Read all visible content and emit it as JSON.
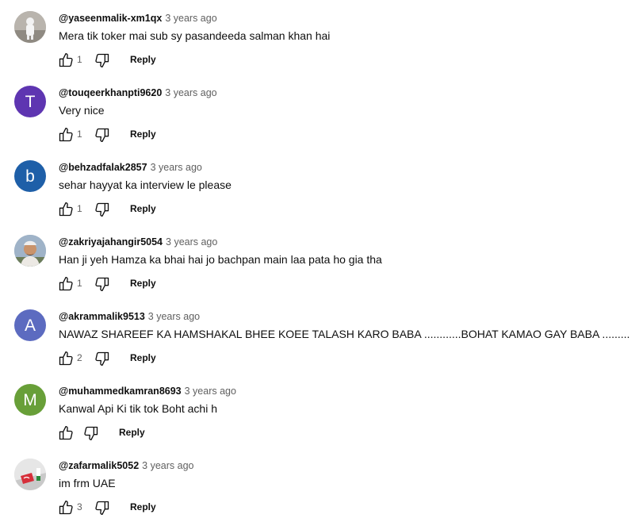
{
  "comments": [
    {
      "author": "@yaseenmalik-xm1qx",
      "time": "3 years ago",
      "text": "Mera tik toker mai sub sy pasandeeda salman khan hai",
      "likes": "1",
      "reply_label": "Reply",
      "avatar": {
        "type": "photo",
        "letter": "",
        "color": "#9e9a95"
      }
    },
    {
      "author": "@touqeerkhanpti9620",
      "time": "3 years ago",
      "text": "Very nice",
      "likes": "1",
      "reply_label": "Reply",
      "avatar": {
        "type": "letter",
        "letter": "T",
        "color": "#5e35b1"
      }
    },
    {
      "author": "@behzadfalak2857",
      "time": "3 years ago",
      "text": "sehar hayyat ka interview le please",
      "likes": "1",
      "reply_label": "Reply",
      "avatar": {
        "type": "letter",
        "letter": "b",
        "color": "#1e5fa8"
      }
    },
    {
      "author": "@zakriyajahangir5054",
      "time": "3 years ago",
      "text": "Han ji yeh Hamza ka bhai hai jo bachpan main laa pata ho gia tha",
      "likes": "1",
      "reply_label": "Reply",
      "avatar": {
        "type": "photo",
        "letter": "",
        "color": "#8aa0b4"
      }
    },
    {
      "author": "@akrammalik9513",
      "time": "3 years ago",
      "text": "NAWAZ SHAREEF KA HAMSHAKAL BHEE KOEE TALASH KARO BABA ............BOHAT KAMAO GAY BABA .........",
      "likes": "2",
      "reply_label": "Reply",
      "avatar": {
        "type": "letter",
        "letter": "A",
        "color": "#5c6bc0"
      }
    },
    {
      "author": "@muhammedkamran8693",
      "time": "3 years ago",
      "text": "Kanwal Api Ki tik tok Boht achi h",
      "likes": "",
      "reply_label": "Reply",
      "avatar": {
        "type": "letter",
        "letter": "M",
        "color": "#689f38"
      }
    },
    {
      "author": "@zafarmalik5052",
      "time": "3 years ago",
      "text": "im frm UAE",
      "likes": "3",
      "reply_label": "Reply",
      "avatar": {
        "type": "photo",
        "letter": "",
        "color": "#d9d9d9"
      }
    }
  ],
  "icons": {
    "like": "thumbs-up-icon",
    "dislike": "thumbs-down-icon"
  }
}
